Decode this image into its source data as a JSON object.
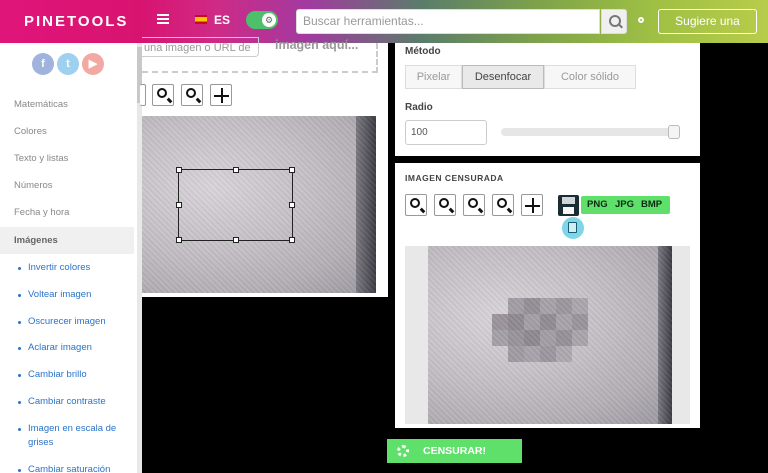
{
  "header": {
    "logo": "PINETOOLS",
    "lang": "ES",
    "search_placeholder": "Buscar herramientas...",
    "suggest_label": "Sugiere una"
  },
  "sidebar": {
    "social": [
      "f",
      "t",
      "▶"
    ],
    "categories": [
      "Matemáticas",
      "Colores",
      "Texto y listas",
      "Números",
      "Fecha y hora",
      "Imágenes"
    ],
    "active_category": "Imágenes",
    "items": [
      "Invertir colores",
      "Voltear imagen",
      "Oscurecer imagen",
      "Aclarar imagen",
      "Cambiar brillo",
      "Cambiar contraste",
      "Imagen en escala de grises",
      "Cambiar saturación"
    ]
  },
  "left_panel": {
    "url_placeholder": "una imagen o URL de",
    "drop_text": "imagen aquí..."
  },
  "method": {
    "label": "Método",
    "options": [
      "Pixelar",
      "Desenfocar",
      "Color sólido"
    ],
    "selected": "Desenfocar"
  },
  "radius": {
    "label": "Radio",
    "value": "100",
    "slider_level": 1.0
  },
  "censored": {
    "title": "IMAGEN CENSURADA",
    "formats": [
      "PNG",
      "JPG",
      "BMP"
    ]
  },
  "action": {
    "censor_label": "CENSURAR!"
  },
  "colors": {
    "accent_green": "#5fe06a",
    "link_blue": "#2a73c9",
    "brand_pink": "#e0157a"
  }
}
